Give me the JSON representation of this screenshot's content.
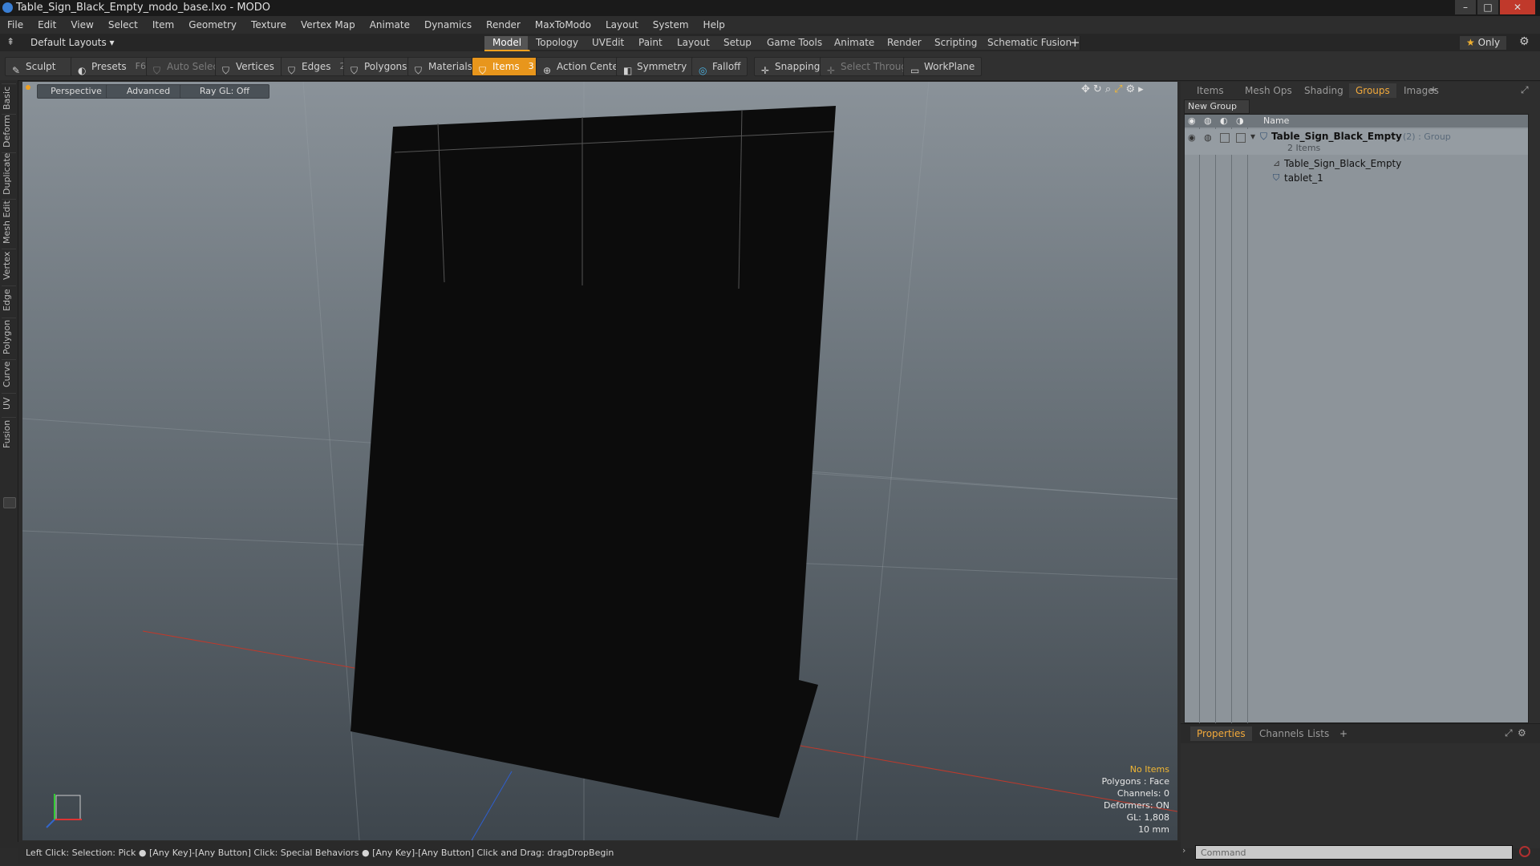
{
  "window": {
    "title": "Table_Sign_Black_Empty_modo_base.lxo - MODO",
    "minimize": "–",
    "maximize": "□",
    "close": "✕"
  },
  "menu": [
    "File",
    "Edit",
    "View",
    "Select",
    "Item",
    "Geometry",
    "Texture",
    "Vertex Map",
    "Animate",
    "Dynamics",
    "Render",
    "MaxToModo",
    "Layout",
    "System",
    "Help"
  ],
  "layouts": {
    "dropdown": "Default Layouts",
    "tabs": [
      "Model",
      "Topology",
      "UVEdit",
      "Paint",
      "Layout",
      "Setup",
      "Game Tools",
      "Animate",
      "Render",
      "Scripting",
      "Schematic Fusion"
    ],
    "active": "Model",
    "add": "+",
    "only": "Only"
  },
  "toolbar": {
    "sculpt": "Sculpt",
    "presets": "Presets",
    "presets_key": "F6",
    "auto_select": "Auto Select",
    "vertices": "Vertices",
    "vertices_count": "1",
    "edges": "Edges",
    "edges_count": "2",
    "polygons": "Polygons",
    "materials": "Materials",
    "items": "Items",
    "items_count": "3",
    "action_center": "Action Center",
    "symmetry": "Symmetry",
    "falloff": "Falloff",
    "snapping": "Snapping",
    "select_through": "Select Through",
    "workplane": "WorkPlane"
  },
  "left_tabs": [
    "Basic",
    "Deform",
    "Duplicate",
    "Mesh Edit",
    "Vertex",
    "Edge",
    "Polygon",
    "Curve",
    "UV",
    "Fusion"
  ],
  "viewport": {
    "perspective": "Perspective",
    "advanced": "Advanced",
    "raygl": "Ray GL: Off",
    "info": {
      "no_items": "No Items",
      "polygons": "Polygons : Face",
      "channels": "Channels: 0",
      "deformers": "Deformers: ON",
      "gl": "GL: 1,808",
      "scale": "10 mm"
    }
  },
  "right_panel": {
    "tabs": [
      "Items",
      "Mesh Ops",
      "Shading",
      "Groups",
      "Images"
    ],
    "active_tab": "Groups",
    "new_group": "New Group",
    "name_header": "Name",
    "group_name": "Table_Sign_Black_Empty",
    "group_meta": "(2) : Group",
    "group_count": "2 Items",
    "children": [
      "Table_Sign_Black_Empty",
      "tablet_1"
    ]
  },
  "props_tabs": [
    "Properties",
    "Channels",
    "Lists"
  ],
  "props_active": "Properties",
  "status": "Left Click: Selection: Pick ● [Any Key]-[Any Button] Click: Special Behaviors ● [Any Key]-[Any Button] Click and Drag: dragDropBegin",
  "command_placeholder": "Command",
  "colors": {
    "accent": "#e8961c",
    "viewport_top": "#8a9299",
    "viewport_bottom": "#3e464d",
    "object": "#0c0c0c"
  }
}
